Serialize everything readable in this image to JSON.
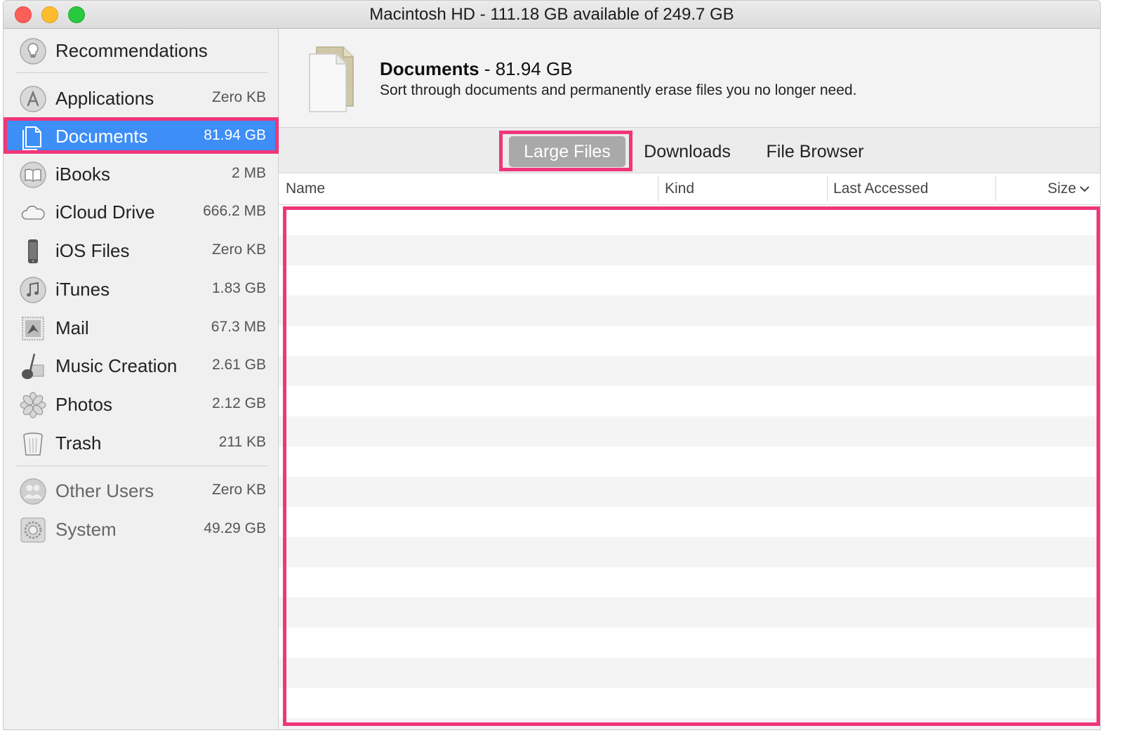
{
  "window": {
    "title": "Macintosh HD - 111.18 GB available of 249.7 GB"
  },
  "sidebar": {
    "top_item": {
      "label": "Recommendations",
      "icon": "lightbulb-icon"
    },
    "items": [
      {
        "label": "Applications",
        "size": "Zero KB",
        "icon": "app-store-icon"
      },
      {
        "label": "Documents",
        "size": "81.94 GB",
        "icon": "document-icon",
        "selected": true
      },
      {
        "label": "iBooks",
        "size": "2 MB",
        "icon": "book-icon"
      },
      {
        "label": "iCloud Drive",
        "size": "666.2 MB",
        "icon": "cloud-icon"
      },
      {
        "label": "iOS Files",
        "size": "Zero KB",
        "icon": "iphone-icon"
      },
      {
        "label": "iTunes",
        "size": "1.83 GB",
        "icon": "music-note-icon"
      },
      {
        "label": "Mail",
        "size": "67.3 MB",
        "icon": "mail-stamp-icon"
      },
      {
        "label": "Music Creation",
        "size": "2.61 GB",
        "icon": "guitar-icon"
      },
      {
        "label": "Photos",
        "size": "2.12 GB",
        "icon": "photos-flower-icon"
      },
      {
        "label": "Trash",
        "size": "211 KB",
        "icon": "trash-icon"
      }
    ],
    "other_items": [
      {
        "label": "Other Users",
        "size": "Zero KB",
        "icon": "users-icon"
      },
      {
        "label": "System",
        "size": "49.29 GB",
        "icon": "gear-icon"
      }
    ]
  },
  "header": {
    "title": "Documents",
    "separator": " - ",
    "size": "81.94 GB",
    "description": "Sort through documents and permanently erase files you no longer need."
  },
  "tabs": [
    {
      "label": "Large Files",
      "active": true
    },
    {
      "label": "Downloads"
    },
    {
      "label": "File Browser"
    }
  ],
  "table": {
    "columns": [
      "Name",
      "Kind",
      "Last Accessed",
      "Size"
    ],
    "sort_indicator": "chevron-down-icon",
    "rows": []
  },
  "colors": {
    "selection": "#3d8ef7",
    "highlight": "#f0367a",
    "active_tab": "#a9a9a9"
  }
}
